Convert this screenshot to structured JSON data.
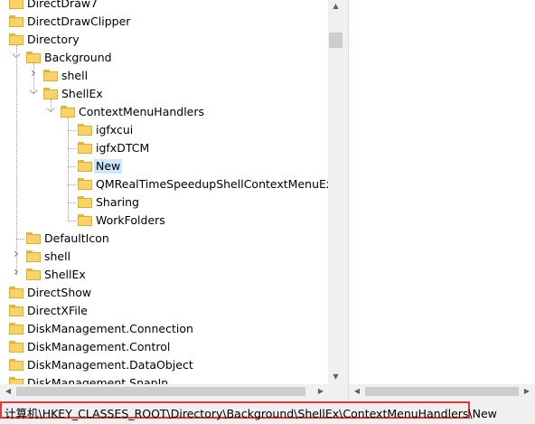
{
  "tree": {
    "items": [
      {
        "label": "DirectDraw7",
        "level": 0,
        "expander": ""
      },
      {
        "label": "DirectDrawClipper",
        "level": 0,
        "expander": ""
      },
      {
        "label": "Directory",
        "level": 0,
        "expander": ""
      },
      {
        "label": "Background",
        "level": 1,
        "expander": "expanded"
      },
      {
        "label": "shell",
        "level": 2,
        "expander": "collapsed"
      },
      {
        "label": "ShellEx",
        "level": 2,
        "expander": "expanded"
      },
      {
        "label": "ContextMenuHandlers",
        "level": 3,
        "expander": "expanded"
      },
      {
        "label": "igfxcui",
        "level": 4,
        "expander": ""
      },
      {
        "label": "igfxDTCM",
        "level": 4,
        "expander": ""
      },
      {
        "label": "New",
        "level": 4,
        "expander": "",
        "selected": true
      },
      {
        "label": "QMRealTimeSpeedupShellContextMenuExter",
        "level": 4,
        "expander": ""
      },
      {
        "label": "Sharing",
        "level": 4,
        "expander": ""
      },
      {
        "label": "WorkFolders",
        "level": 4,
        "expander": ""
      },
      {
        "label": "DefaultIcon",
        "level": 1,
        "expander": ""
      },
      {
        "label": "shell",
        "level": 1,
        "expander": "collapsed"
      },
      {
        "label": "ShellEx",
        "level": 1,
        "expander": "collapsed"
      },
      {
        "label": "DirectShow",
        "level": 0,
        "expander": ""
      },
      {
        "label": "DirectXFile",
        "level": 0,
        "expander": ""
      },
      {
        "label": "DiskManagement.Connection",
        "level": 0,
        "expander": ""
      },
      {
        "label": "DiskManagement.Control",
        "level": 0,
        "expander": ""
      },
      {
        "label": "DiskManagement.DataObject",
        "level": 0,
        "expander": ""
      },
      {
        "label": "DiskManagement.SnapIn",
        "level": 0,
        "expander": ""
      }
    ]
  },
  "status": {
    "path": "计算机\\HKEY_CLASSES_ROOT\\Directory\\Background\\ShellEx\\ContextMenuHandlers\\New"
  },
  "icons": {
    "folder": "folder-icon",
    "expanded": "chevron-down-icon",
    "collapsed": "chevron-right-icon"
  },
  "colors": {
    "selection": "#cce8ff",
    "highlight_border": "#e53935",
    "folder": "#f7d368"
  }
}
